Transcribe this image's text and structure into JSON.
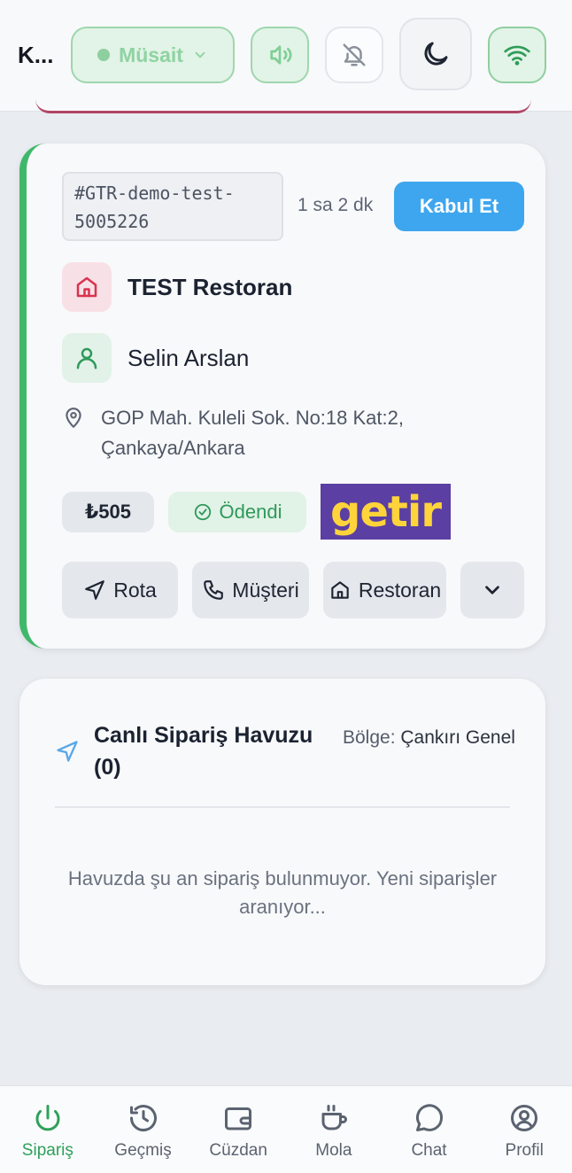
{
  "header": {
    "title": "K...",
    "status_label": "Müsait"
  },
  "order": {
    "id": "#GTR-demo-test-5005226",
    "elapsed": "1 sa 2 dk",
    "accept_label": "Kabul Et",
    "restaurant": "TEST Restoran",
    "customer": "Selin Arslan",
    "address": "GOP Mah. Kuleli Sok. No:18 Kat:2, Çankaya/Ankara",
    "price": "₺505",
    "payment_status": "Ödendi",
    "platform": "getir",
    "actions": {
      "route": "Rota",
      "customer": "Müşteri",
      "restaurant": "Restoran"
    }
  },
  "pool": {
    "title": "Canlı Sipariş Havuzu (0)",
    "region_label": "Bölge:",
    "region_value": "Çankırı Genel",
    "empty_text": "Havuzda şu an sipariş bulunmuyor. Yeni siparişler aranıyor..."
  },
  "nav": {
    "items": [
      {
        "label": "Sipariş",
        "icon": "power-icon"
      },
      {
        "label": "Geçmiş",
        "icon": "history-icon"
      },
      {
        "label": "Cüzdan",
        "icon": "wallet-icon"
      },
      {
        "label": "Mola",
        "icon": "coffee-icon"
      },
      {
        "label": "Chat",
        "icon": "chat-icon"
      },
      {
        "label": "Profil",
        "icon": "profile-icon"
      }
    ]
  },
  "colors": {
    "accent_green": "#3fb86a",
    "accept_blue": "#3da6ef",
    "getir_purple": "#5b3fa3",
    "getir_yellow": "#ffd43b"
  }
}
